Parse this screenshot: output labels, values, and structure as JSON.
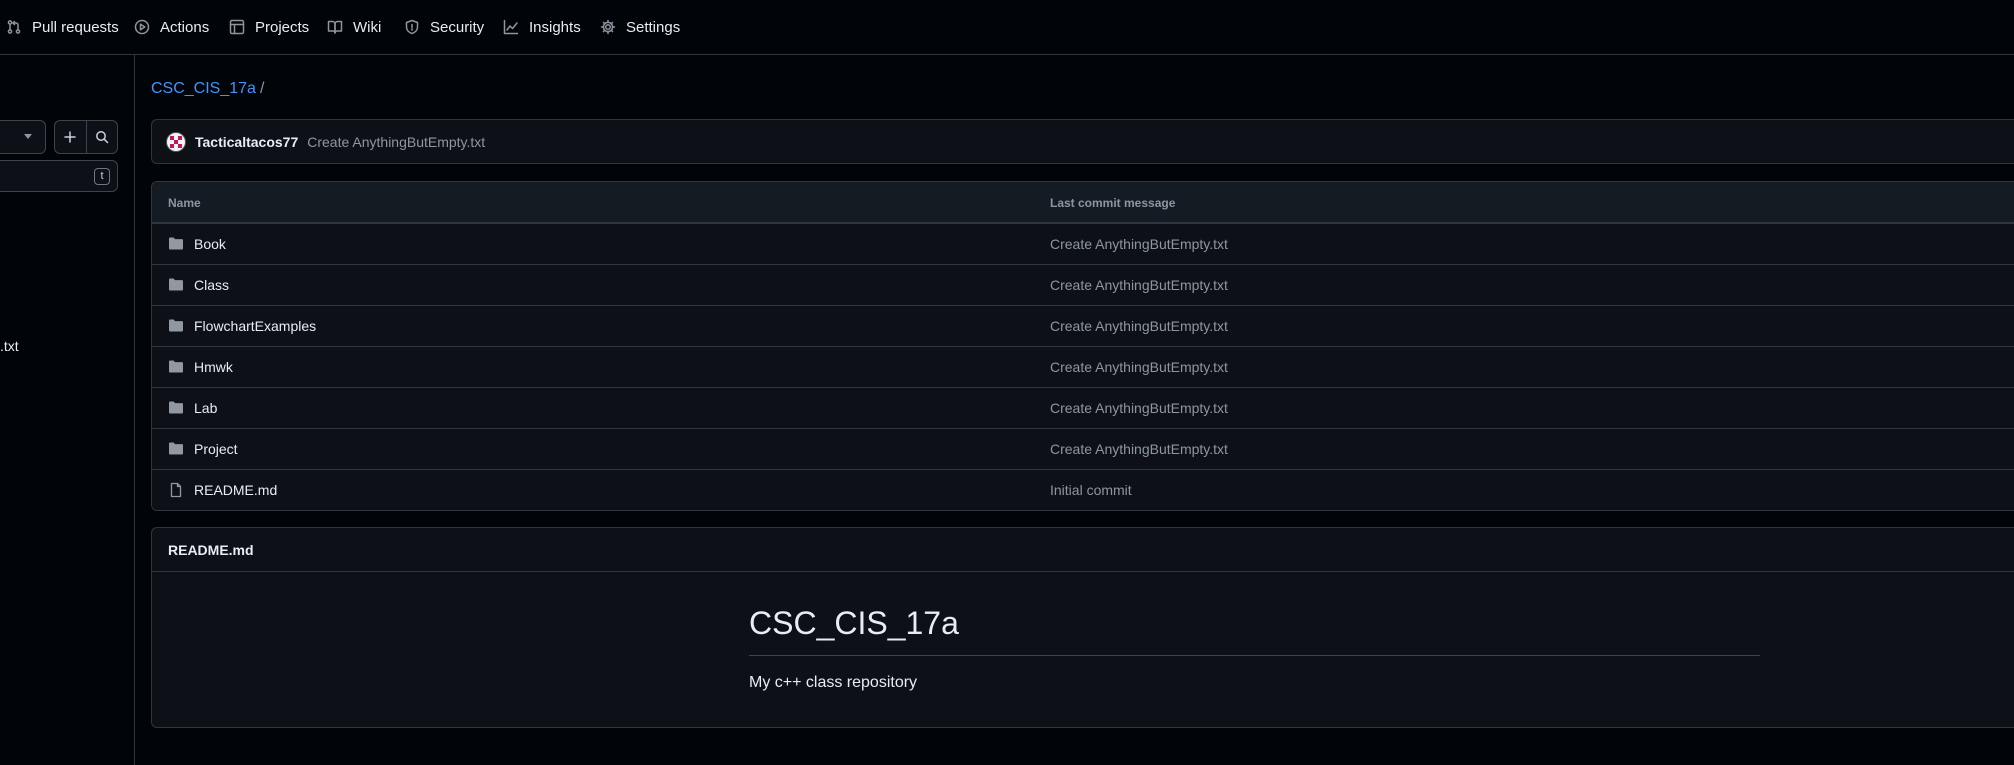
{
  "nav": {
    "items": [
      {
        "label": "Pull requests",
        "icon": "git-pull-request-icon"
      },
      {
        "label": "Actions",
        "icon": "play-icon"
      },
      {
        "label": "Projects",
        "icon": "table-icon"
      },
      {
        "label": "Wiki",
        "icon": "book-icon"
      },
      {
        "label": "Security",
        "icon": "shield-icon"
      },
      {
        "label": "Insights",
        "icon": "graph-icon"
      },
      {
        "label": "Settings",
        "icon": "gear-icon"
      }
    ]
  },
  "sidebar": {
    "filter_shortcut": "t",
    "tree_fragment": ".txt"
  },
  "breadcrumb": {
    "repo": "CSC_CIS_17a",
    "separator": "/"
  },
  "latest_commit": {
    "author": "Tacticaltacos77",
    "message": "Create AnythingButEmpty.txt"
  },
  "files": {
    "headers": {
      "name": "Name",
      "message": "Last commit message"
    },
    "rows": [
      {
        "name": "Book",
        "type": "folder",
        "message": "Create AnythingButEmpty.txt"
      },
      {
        "name": "Class",
        "type": "folder",
        "message": "Create AnythingButEmpty.txt"
      },
      {
        "name": "FlowchartExamples",
        "type": "folder",
        "message": "Create AnythingButEmpty.txt"
      },
      {
        "name": "Hmwk",
        "type": "folder",
        "message": "Create AnythingButEmpty.txt"
      },
      {
        "name": "Lab",
        "type": "folder",
        "message": "Create AnythingButEmpty.txt"
      },
      {
        "name": "Project",
        "type": "folder",
        "message": "Create AnythingButEmpty.txt"
      },
      {
        "name": "README.md",
        "type": "file",
        "message": "Initial commit"
      }
    ]
  },
  "readme": {
    "filename": "README.md",
    "heading": "CSC_CIS_17a",
    "body": "My c++ class repository"
  },
  "colors": {
    "background": "#010409",
    "surface": "#0d1117",
    "border": "#30363d",
    "link": "#4493f8",
    "muted": "#8d96a0",
    "folder": "#9198a1"
  }
}
